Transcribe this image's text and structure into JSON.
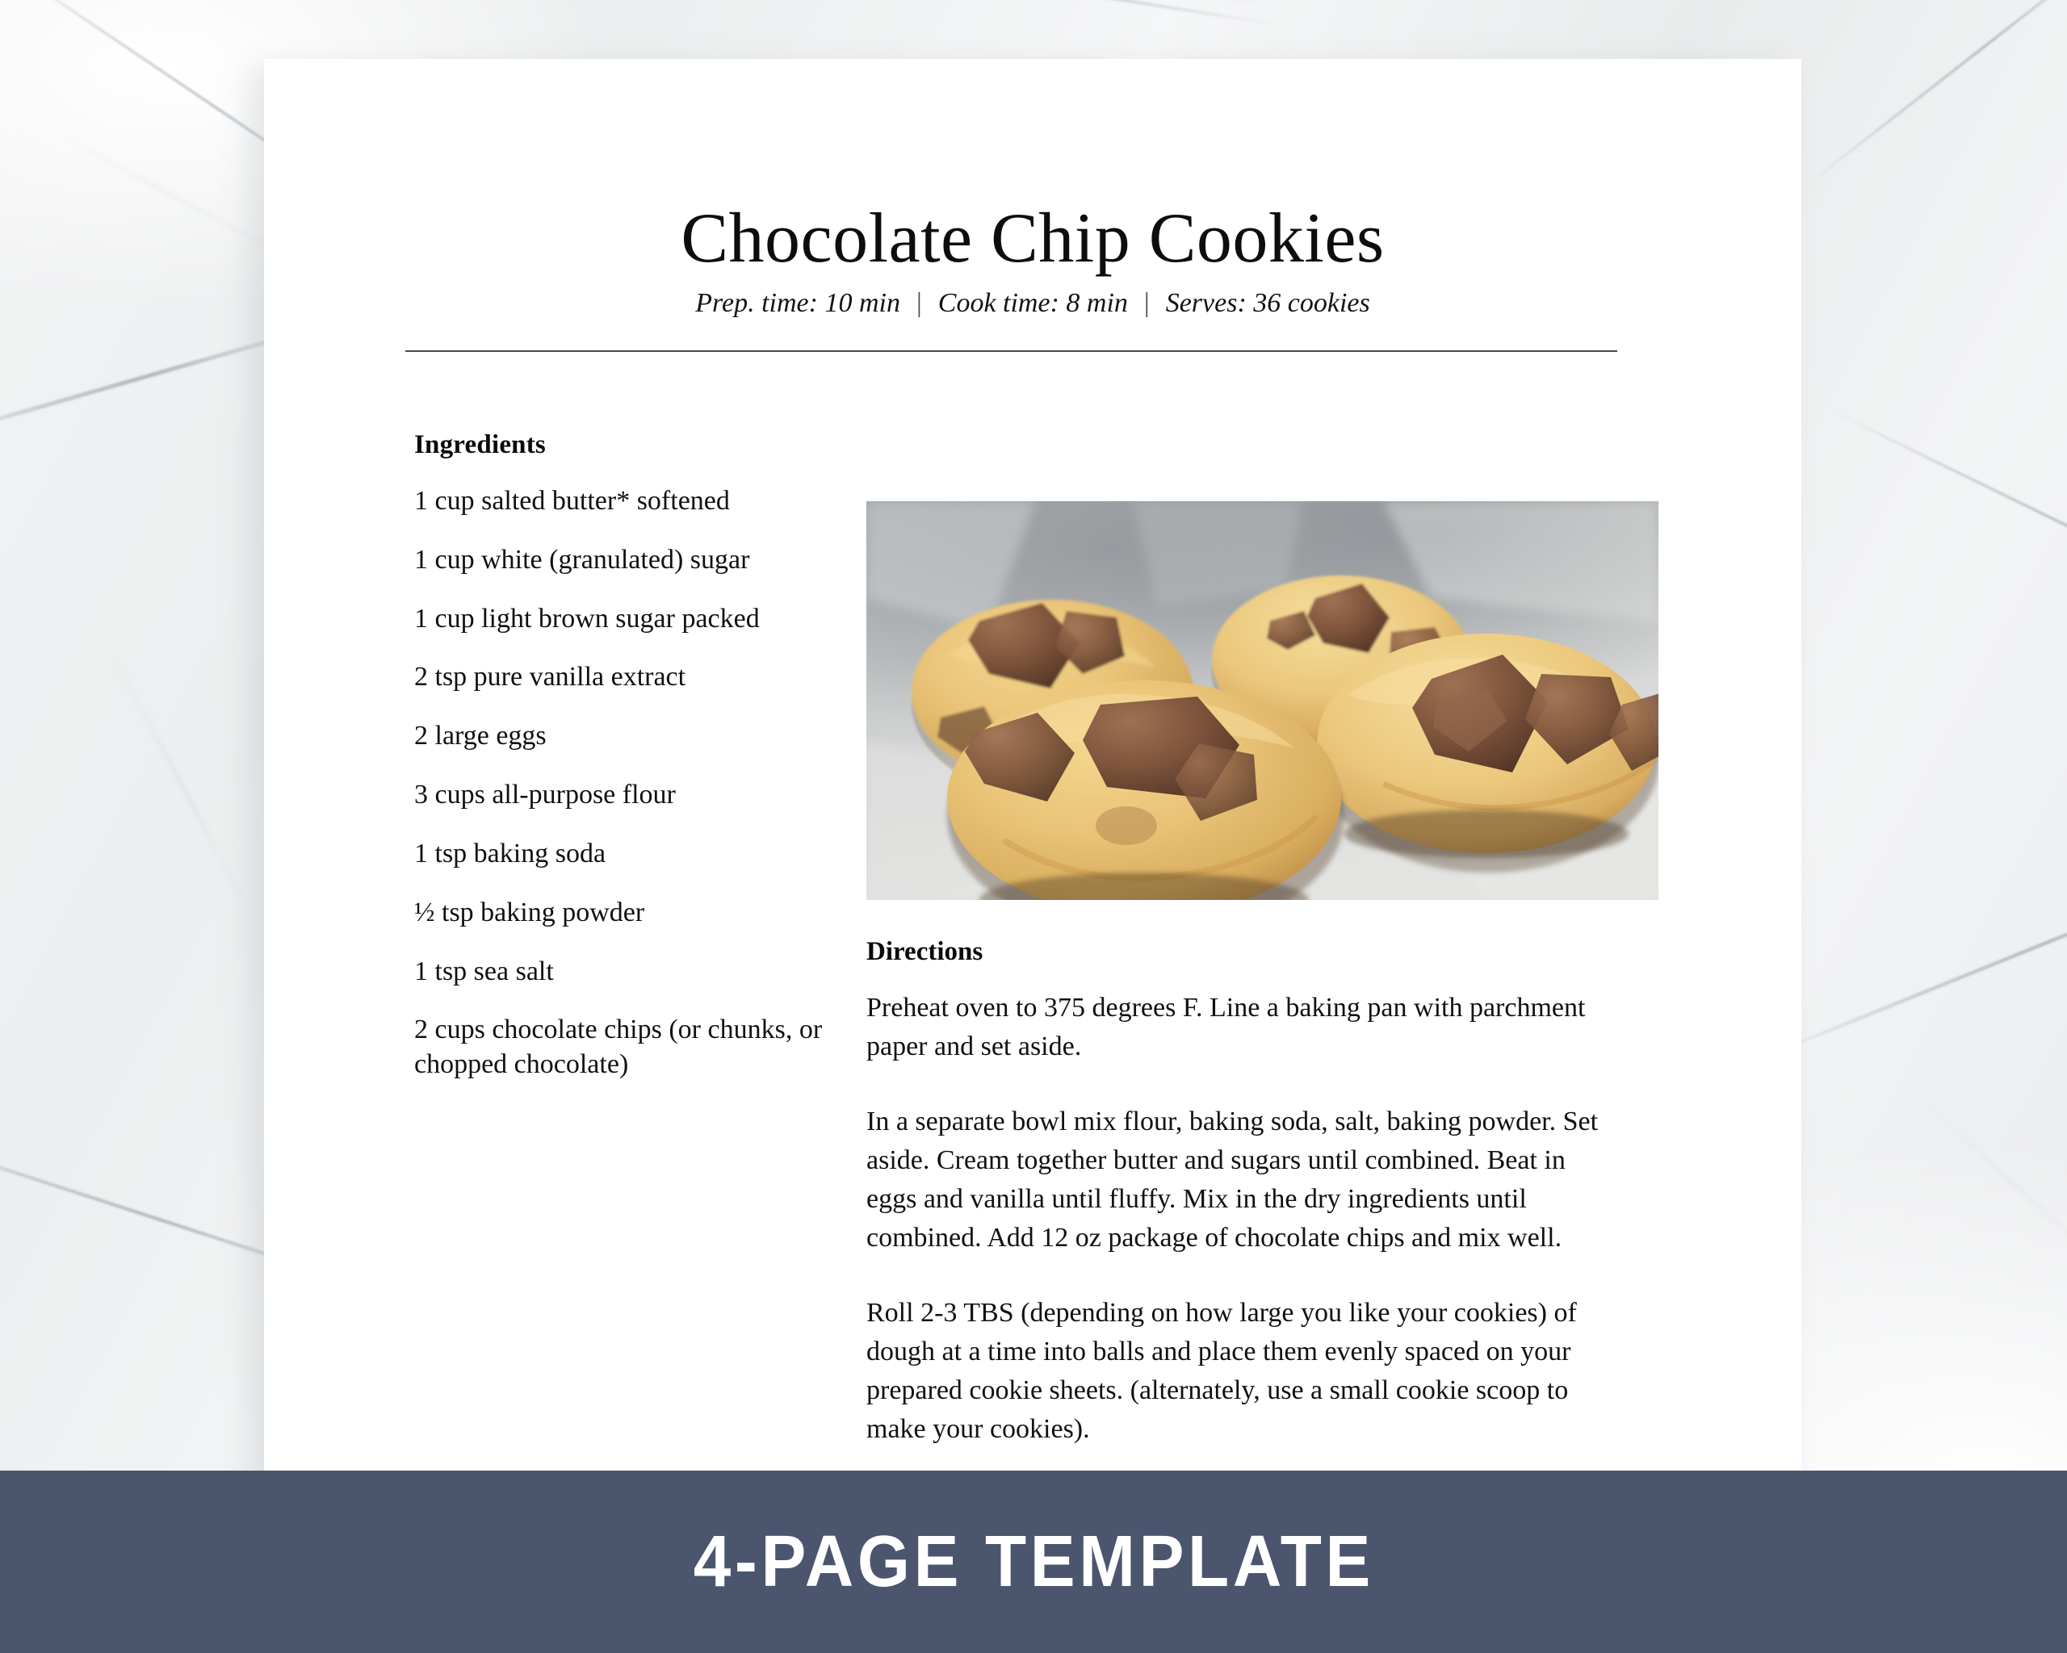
{
  "background": {
    "surface": "marble",
    "color": "#eef0f1"
  },
  "page": {
    "background": "#ffffff"
  },
  "header": {
    "title": "Chocolate Chip Cookies",
    "meta": {
      "prep_time": "Prep. time: 10 min",
      "cook_time": "Cook time: 8 min",
      "serves": "Serves: 36 cookies",
      "separator": "|"
    },
    "rule_color": "#4c4c4c"
  },
  "ingredients": {
    "heading": "Ingredients",
    "items": [
      "1 cup salted butter* softened",
      "1 cup white (granulated) sugar",
      "1 cup light brown sugar packed",
      "2 tsp pure vanilla extract",
      "2 large eggs",
      "3 cups all-purpose flour",
      "1 tsp baking soda",
      "½ tsp baking powder",
      "1 tsp sea salt",
      "2 cups chocolate chips (or chunks, or chopped chocolate)"
    ]
  },
  "photo": {
    "alt": "Four chocolate chunk cookies cooling on parchment paper",
    "cookie_count": 4
  },
  "directions": {
    "heading": "Directions",
    "steps": [
      "Preheat oven to 375 degrees F. Line a baking pan with parchment paper and set aside.",
      "In a separate bowl mix flour, baking soda, salt, baking powder. Set aside. Cream together butter and sugars until combined. Beat in eggs and vanilla until fluffy. Mix in the dry ingredients until combined. Add 12 oz package of chocolate chips and mix well.",
      "Roll 2-3 TBS (depending on how large you like your cookies) of dough at a time into balls and place them evenly spaced on your prepared cookie sheets. (alternately, use a small cookie scoop to make your cookies)."
    ]
  },
  "banner": {
    "text": "4-PAGE TEMPLATE",
    "background_color": "#4b556e",
    "text_color": "#ffffff"
  }
}
